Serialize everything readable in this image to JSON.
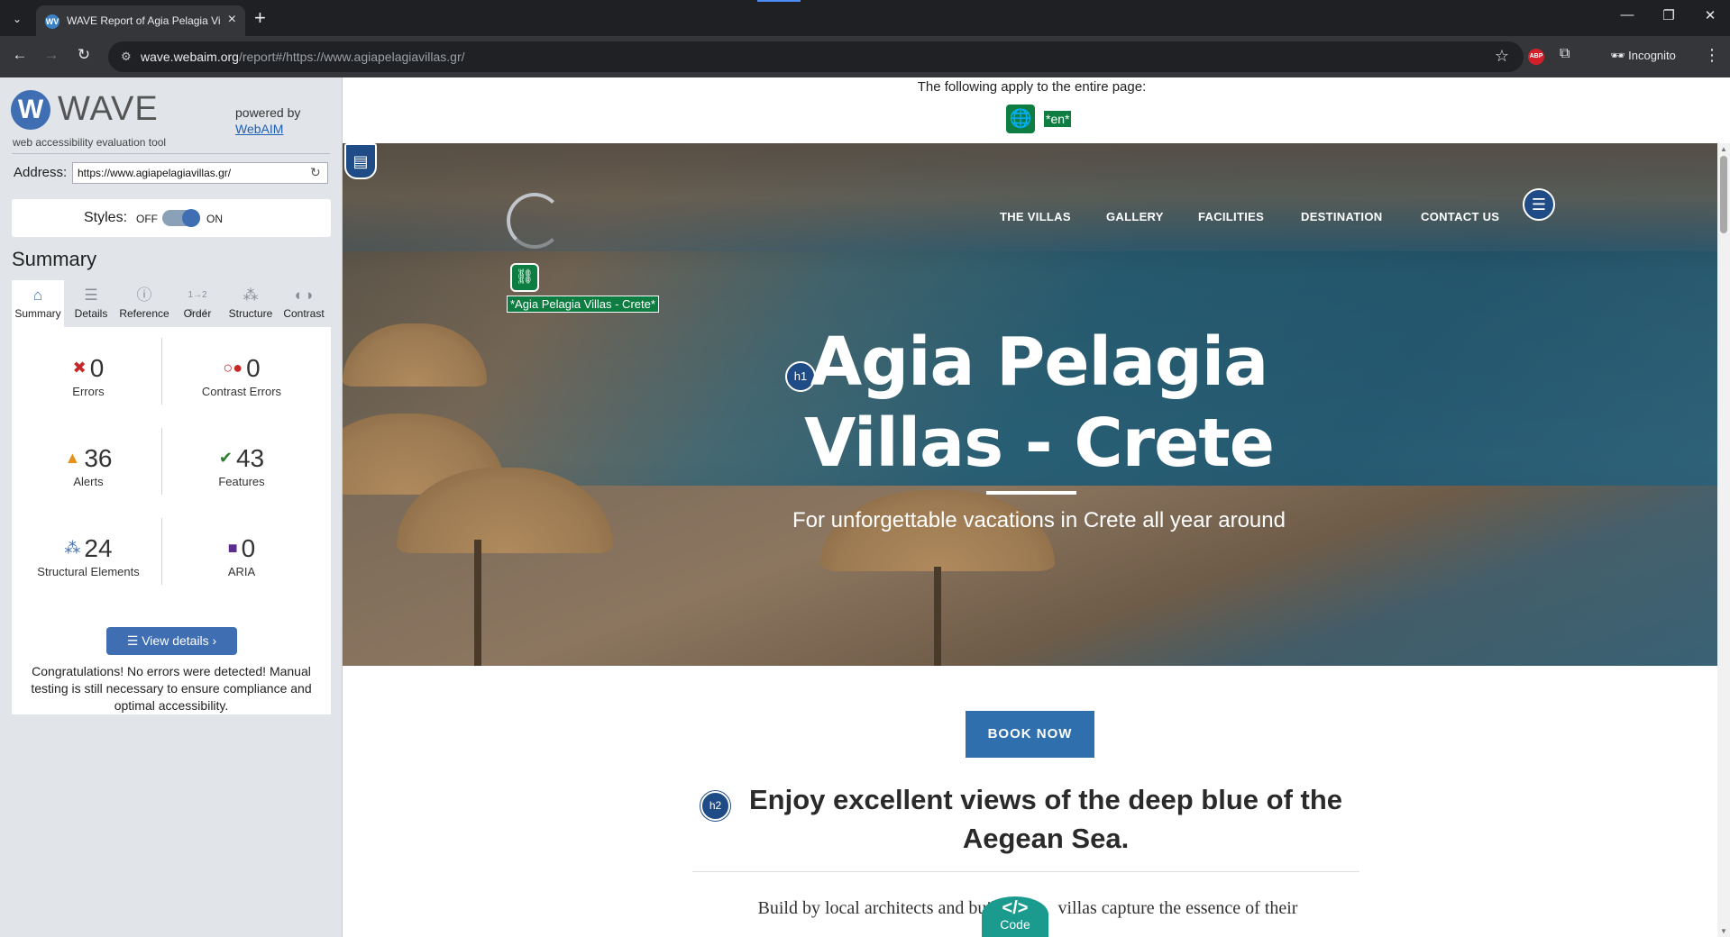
{
  "browser": {
    "tab_title": "WAVE Report of Agia Pelagia Vi",
    "tab_favicon": "WV",
    "url_host": "wave.webaim.org",
    "url_path": "/report#/https://www.agiapelagiavillas.gr/",
    "abp_label": "ABP",
    "incognito_label": "Incognito",
    "icons": [
      "tab-list-icon",
      "close-icon",
      "new-tab-icon",
      "minimize-icon",
      "restore-icon",
      "window-close-icon",
      "back-icon",
      "forward-icon",
      "reload-icon",
      "site-controls-icon",
      "bookmark-star-icon",
      "extensions-icon",
      "incognito-icon",
      "more-menu-icon"
    ]
  },
  "wave": {
    "logo_text": "WAVE",
    "logo_sub": "web accessibility evaluation tool",
    "powered_by": "powered by",
    "webaim_link": "WebAIM",
    "address_label": "Address:",
    "address_value": "https://www.agiapelagiavillas.gr/",
    "styles_label": "Styles:",
    "styles_off": "OFF",
    "styles_on": "ON",
    "styles_state": "on",
    "summary_heading": "Summary",
    "tabs": [
      {
        "label": "Summary",
        "icon": "home-icon",
        "active": true
      },
      {
        "label": "Details",
        "icon": "list-icon",
        "active": false
      },
      {
        "label": "Reference",
        "icon": "info-icon",
        "active": false
      },
      {
        "label": "Order",
        "icon": "order-icon",
        "active": false
      },
      {
        "label": "Structure",
        "icon": "structure-icon",
        "active": false
      },
      {
        "label": "Contrast",
        "icon": "contrast-icon",
        "active": false
      }
    ],
    "stats": {
      "errors": {
        "value": "0",
        "label": "Errors",
        "color": "#c62828"
      },
      "contrast_errors": {
        "value": "0",
        "label": "Contrast Errors",
        "color": "#c62828"
      },
      "alerts": {
        "value": "36",
        "label": "Alerts",
        "color": "#e3931b"
      },
      "features": {
        "value": "43",
        "label": "Features",
        "color": "#2e7d32"
      },
      "structural": {
        "value": "24",
        "label": "Structural Elements",
        "color": "#3f6eb3"
      },
      "aria": {
        "value": "0",
        "label": "ARIA",
        "color": "#5b2d8e"
      }
    },
    "view_details": "View details ›",
    "congrats": "Congratulations! No errors were detected! Manual testing is still necessary to ensure compliance and optimal accessibility."
  },
  "page": {
    "applies_text": "The following apply to the entire page:",
    "lang_tag": "*en*",
    "logo_alt_tag": "*Agia Pelagia Villas - Crete*",
    "nav": [
      "THE VILLAS",
      "GALLERY",
      "FACILITIES",
      "DESTINATION",
      "CONTACT US"
    ],
    "h1_badge": "h1",
    "hero_title_line1": "Agia Pelagia",
    "hero_title_line2": "Villas - Crete",
    "hero_subtitle": "For unforgettable vacations in Crete all year around",
    "book_now": "BOOK NOW",
    "h2_badge": "h2",
    "h2_text": "Enjoy excellent views of the deep blue of the Aegean Sea.",
    "body_text_left": "Build by local architects and buil",
    "body_text_right": "villas capture the essence of their",
    "code_symbol": "</>",
    "code_label": "Code"
  }
}
